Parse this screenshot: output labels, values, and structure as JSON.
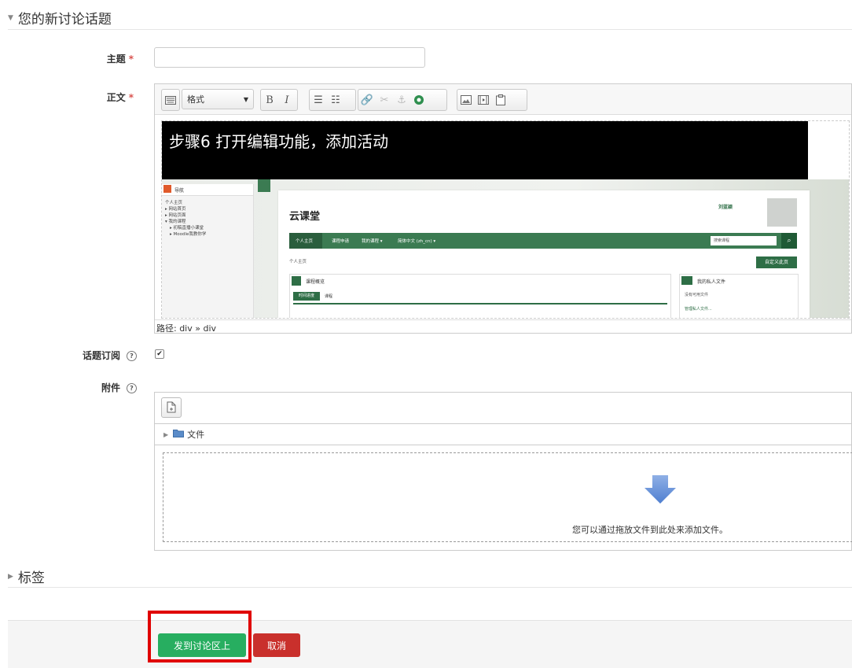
{
  "section_discussion": {
    "title": "您的新讨论话题"
  },
  "fields": {
    "subject_label": "主题",
    "body_label": "正文",
    "required_mark": "*",
    "subscribe_label": "话题订阅",
    "attachment_label": "附件",
    "help_glyph": "?"
  },
  "editor": {
    "format_label": "格式",
    "bold_label": "B",
    "italic_label": "I",
    "heading_text": "步骤6 打开编辑功能，添加活动",
    "path_text": "路径: div » div",
    "screenshot": {
      "nav_label": "导航",
      "side_items": [
        "个人主页",
        "▸ 网站首页",
        "▸ 网站页面",
        "▾ 我的课程",
        "▸ 初稿直播小课堂",
        "▸ Moodle我教你学"
      ],
      "brand": "云课堂",
      "username": "刘蓝颖",
      "nav_items": [
        "个人主页",
        "课程申请",
        "我的课程 ▾",
        "简体中文 (zh_cn) ▾"
      ],
      "search_placeholder": "搜索课程",
      "breadcrumb": "个人主页",
      "customize_button": "自定义此页",
      "course_overview": "课程概览",
      "tabs": [
        "时间进度",
        "课程"
      ],
      "private_files": "我的私人文件",
      "no_files": "没有可用文件",
      "manage_files": "管理私人文件..."
    }
  },
  "filemanager": {
    "folder_label": "文件",
    "drop_hint": "您可以通过拖放文件到此处来添加文件。"
  },
  "section_tags": {
    "title": "标签"
  },
  "buttons": {
    "submit": "发到讨论区上",
    "cancel": "取消"
  },
  "colors": {
    "submit": "#27ae60",
    "cancel": "#c9302c",
    "highlight": "#e00000",
    "required": "#d9534f"
  }
}
